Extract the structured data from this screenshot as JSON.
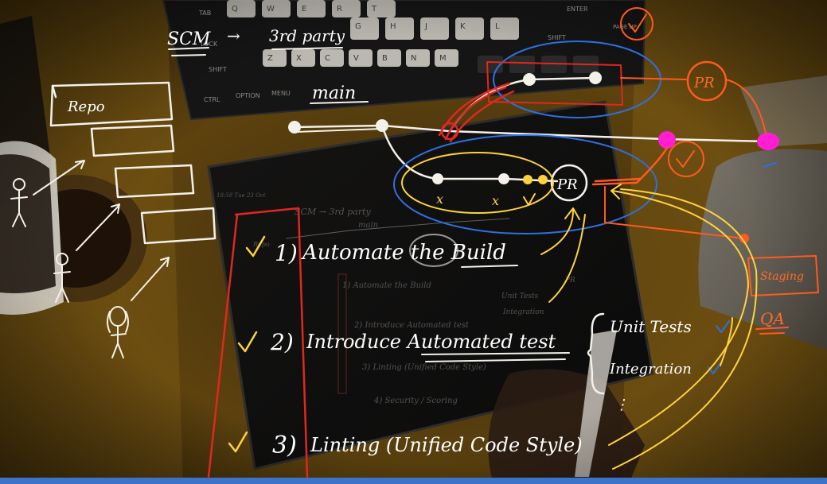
{
  "keyboard": {
    "row1": [
      "Q",
      "W",
      "E",
      "R",
      "T"
    ],
    "row2": [
      "G",
      "H",
      "J",
      "K",
      "L"
    ],
    "row3": [
      "Z",
      "X",
      "C",
      "V",
      "B",
      "N",
      "M"
    ],
    "tab": "TAB",
    "lock": "LOCK",
    "shift_left": "SHIFT",
    "shift_right": "SHIFT",
    "ctrl": "CTRL",
    "option": "OPTION",
    "menu": "MENU",
    "enter": "ENTER",
    "page_up": "PAGE UP"
  },
  "annotations": {
    "scm": "SCM",
    "arrow": "→",
    "third_party": "3rd party",
    "main": "main",
    "repo": "Repo",
    "pr_top": "PR",
    "pr_center": "PR",
    "x1": "x",
    "x2": "x",
    "staging": "Staging",
    "qa": "QA",
    "step1_num": "1)",
    "step1_text": "Automate the Build",
    "step2_num": "2)",
    "step2_text": "Introduce Automated test",
    "step3_num": "3)",
    "step3_text": "Linting (Unified Code Style)",
    "unit_tests": "Unit Tests",
    "integration": "Integration",
    "ellipsis": "⋮",
    "check": "✓"
  },
  "tablet_ghost": {
    "time": "18:58  Tue 23 Oct",
    "scm": "SCM → 3rd party",
    "main": "main",
    "repo": "Repo",
    "s1": "1) Automate the Build",
    "s2": "2) Introduce Automated test",
    "s3": "3) Linting (Unified Code Style)",
    "s4": "4) Security / Scoring",
    "unit": "Unit Tests",
    "integ": "Integration",
    "pr": "PR"
  },
  "colors": {
    "desk": "#c79a2b",
    "ink_white": "#f4f1ea",
    "ink_yellow": "#ffd23c",
    "ink_orange": "#ff5a1e",
    "ink_red": "#e0281e",
    "ink_blue": "#2f6fe0",
    "ink_magenta": "#ff1ed2"
  }
}
